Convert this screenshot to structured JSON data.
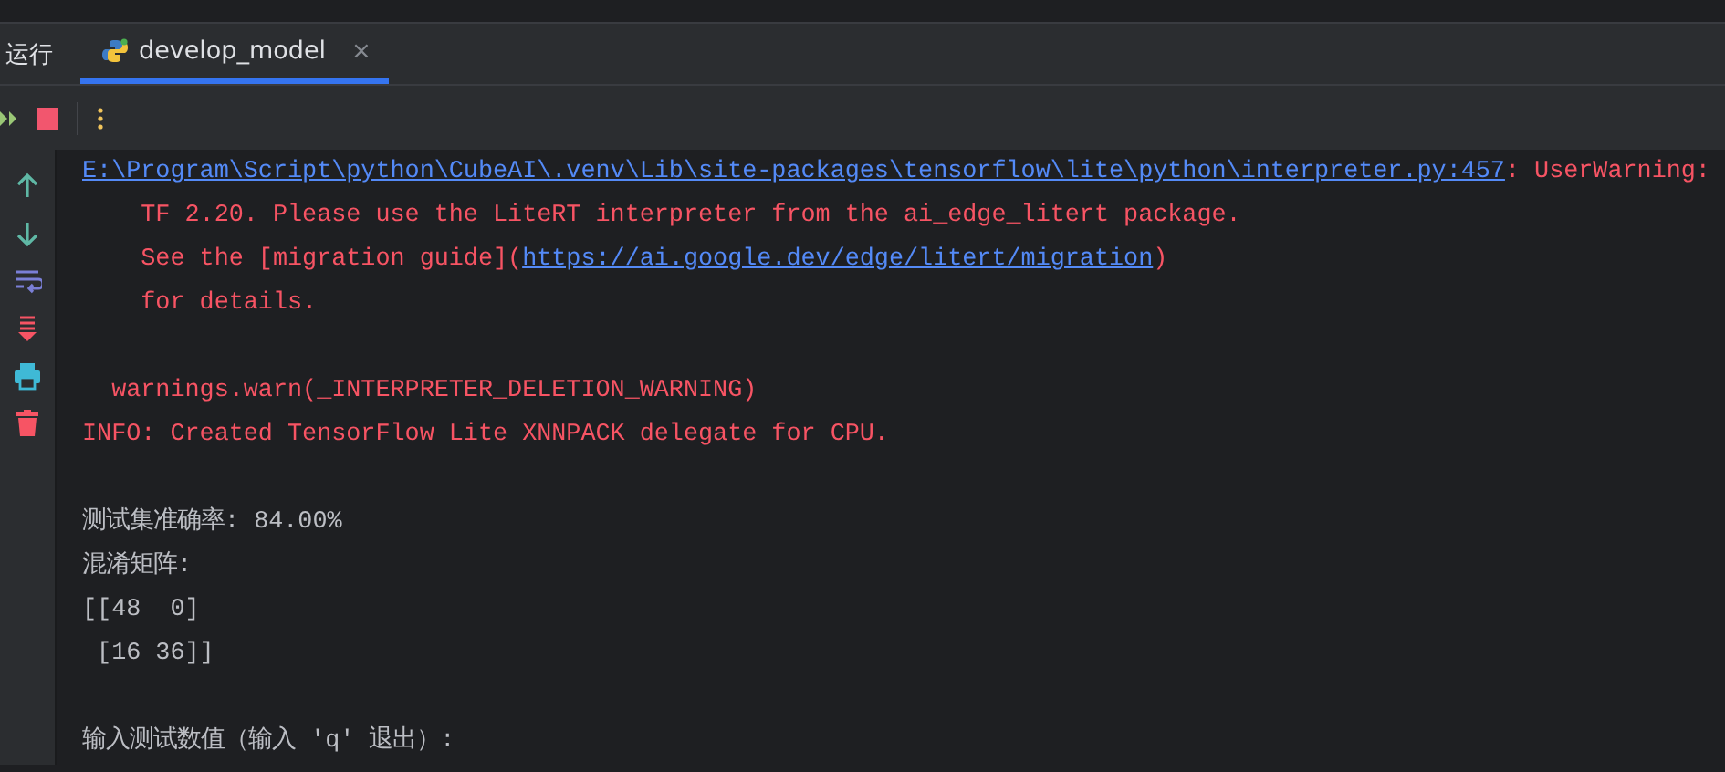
{
  "tool_window": {
    "title": "运行"
  },
  "tabs": [
    {
      "label": "develop_model",
      "close": "×",
      "selected": true
    }
  ],
  "console": {
    "blocks": [
      [
        {
          "segments": [
            {
              "kind": "link",
              "text": "E:\\Program\\Script\\python\\CubeAI\\.venv\\Lib\\site-packages\\tensorflow\\lite\\python\\interpreter.py:457"
            },
            {
              "kind": "error",
              "text": ": UserWarning:"
            }
          ]
        },
        {
          "segments": [
            {
              "kind": "error",
              "text": "    TF 2.20. Please use the LiteRT interpreter from the ai_edge_litert package."
            }
          ]
        },
        {
          "segments": [
            {
              "kind": "error",
              "text": "    See the [migration guide]("
            },
            {
              "kind": "link",
              "text": "https://ai.google.dev/edge/litert/migration"
            },
            {
              "kind": "error",
              "text": ")"
            }
          ]
        },
        {
          "segments": [
            {
              "kind": "error",
              "text": "    for details."
            }
          ]
        }
      ],
      [
        {
          "segments": [
            {
              "kind": "error",
              "text": "  warnings.warn(_INTERPRETER_DELETION_WARNING)"
            }
          ]
        },
        {
          "segments": [
            {
              "kind": "error",
              "text": "INFO: Created TensorFlow Lite XNNPACK delegate for CPU."
            }
          ]
        }
      ],
      [
        {
          "segments": [
            {
              "kind": "normal",
              "text": "测试集准确率: 84.00%"
            }
          ]
        },
        {
          "segments": [
            {
              "kind": "normal",
              "text": "混淆矩阵:"
            }
          ]
        },
        {
          "segments": [
            {
              "kind": "normal",
              "text": "[[48  0]"
            }
          ]
        },
        {
          "segments": [
            {
              "kind": "normal",
              "text": " [16 36]]"
            }
          ]
        }
      ],
      [
        {
          "segments": [
            {
              "kind": "normal",
              "text": "输入测试数值（输入 'q' 退出）:"
            }
          ]
        }
      ]
    ]
  }
}
